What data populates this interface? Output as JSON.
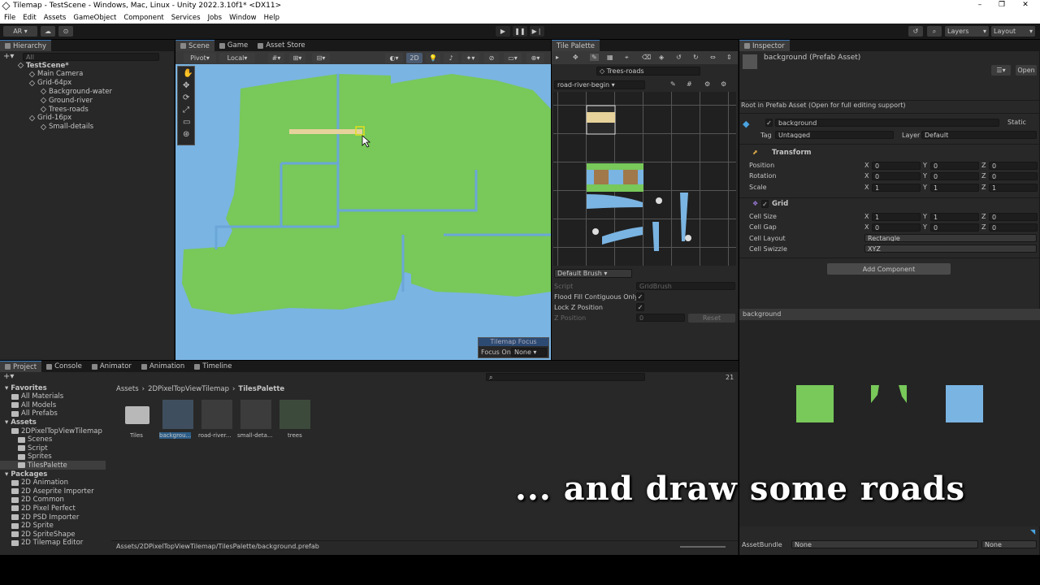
{
  "window": {
    "title": "Tilemap - TestScene - Windows, Mac, Linux - Unity 2022.3.10f1* <DX11>",
    "min": "–",
    "max": "❐",
    "close": "✕"
  },
  "menu": [
    "File",
    "Edit",
    "Assets",
    "GameObject",
    "Component",
    "Services",
    "Jobs",
    "Window",
    "Help"
  ],
  "toolbar": {
    "account": "AR",
    "layers": "Layers",
    "layout": "Layout",
    "play": "▶",
    "pause": "❚❚",
    "step": "▶❘"
  },
  "hierarchy": {
    "tab": "Hierarchy",
    "search": "All",
    "items": [
      {
        "label": "TestScene*",
        "indent": 0,
        "bold": true
      },
      {
        "label": "Main Camera",
        "indent": 1
      },
      {
        "label": "Grid-64px",
        "indent": 1
      },
      {
        "label": "Background-water",
        "indent": 2
      },
      {
        "label": "Ground-river",
        "indent": 2
      },
      {
        "label": "Trees-roads",
        "indent": 2
      },
      {
        "label": "Grid-16px",
        "indent": 1
      },
      {
        "label": "Small-details",
        "indent": 2
      }
    ]
  },
  "scene": {
    "tabs": [
      "Scene",
      "Game",
      "Asset Store"
    ],
    "pivot": "Pivot",
    "local": "Local",
    "mode2d": "2D",
    "focus_title": "Tilemap Focus",
    "focus_on": "Focus On",
    "focus_value": "None"
  },
  "palette": {
    "tab": "Tile Palette",
    "target": "Trees-roads",
    "palette_name": "road-river-begin",
    "brush": "Default Brush",
    "script_label": "Script",
    "script_value": "GridBrush",
    "flood_label": "Flood Fill Contiguous Only",
    "lockz_label": "Lock Z Position",
    "zpos_label": "Z Position",
    "zpos_value": "0",
    "reset": "Reset",
    "check": "✓"
  },
  "inspector": {
    "tab": "Inspector",
    "asset_title": "background (Prefab Asset)",
    "open": "Open",
    "root_note": "Root in Prefab Asset (Open for full editing support)",
    "name": "background",
    "static": "Static",
    "tag_label": "Tag",
    "tag": "Untagged",
    "layer_label": "Layer",
    "layer": "Default",
    "transform": {
      "title": "Transform",
      "rows": [
        {
          "label": "Position",
          "x": "0",
          "y": "0",
          "z": "0"
        },
        {
          "label": "Rotation",
          "x": "0",
          "y": "0",
          "z": "0"
        },
        {
          "label": "Scale",
          "x": "1",
          "y": "1",
          "z": "1"
        }
      ]
    },
    "grid": {
      "title": "Grid",
      "rows": [
        {
          "label": "Cell Size",
          "x": "1",
          "y": "1",
          "z": "0"
        },
        {
          "label": "Cell Gap",
          "x": "0",
          "y": "0",
          "z": "0"
        }
      ],
      "layout_label": "Cell Layout",
      "layout": "Rectangle",
      "swizzle_label": "Cell Swizzle",
      "swizzle": "XYZ"
    },
    "add_component": "Add Component",
    "preview_title": "background",
    "assetbundle_label": "AssetBundle",
    "assetbundle": "None",
    "assetbundle_variant": "None"
  },
  "project": {
    "tabs": [
      "Project",
      "Console",
      "Animator",
      "Animation",
      "Timeline"
    ],
    "count": "21",
    "tree": [
      {
        "label": "Favorites",
        "indent": 0,
        "bold": true
      },
      {
        "label": "All Materials",
        "indent": 1
      },
      {
        "label": "All Models",
        "indent": 1
      },
      {
        "label": "All Prefabs",
        "indent": 1
      },
      {
        "label": "Assets",
        "indent": 0,
        "bold": true
      },
      {
        "label": "2DPixelTopViewTilemap",
        "indent": 1
      },
      {
        "label": "Scenes",
        "indent": 2
      },
      {
        "label": "Script",
        "indent": 2
      },
      {
        "label": "Sprites",
        "indent": 2
      },
      {
        "label": "TilesPalette",
        "indent": 2,
        "selected": true
      },
      {
        "label": "Packages",
        "indent": 0,
        "bold": true
      },
      {
        "label": "2D Animation",
        "indent": 1
      },
      {
        "label": "2D Aseprite Importer",
        "indent": 1
      },
      {
        "label": "2D Common",
        "indent": 1
      },
      {
        "label": "2D Pixel Perfect",
        "indent": 1
      },
      {
        "label": "2D PSD Importer",
        "indent": 1
      },
      {
        "label": "2D Sprite",
        "indent": 1
      },
      {
        "label": "2D SpriteShape",
        "indent": 1
      },
      {
        "label": "2D Tilemap Editor",
        "indent": 1
      }
    ],
    "breadcrumb": [
      "Assets",
      "2DPixelTopViewTilemap",
      "TilesPalette"
    ],
    "assets": [
      "Tiles",
      "backgrou...",
      "road-river...",
      "small-deta...",
      "trees"
    ],
    "path": "Assets/2DPixelTopViewTilemap/TilesPalette/background.prefab"
  },
  "caption": "... and draw some roads",
  "colors": {
    "grass": "#78c85a",
    "water": "#7ab4e2",
    "road": "#e6d29a",
    "accent": "#3a79bb"
  }
}
